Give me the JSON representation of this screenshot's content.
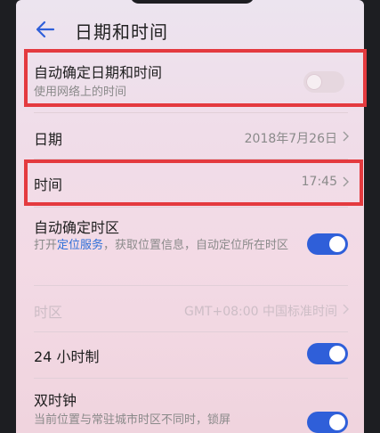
{
  "header": {
    "title": "日期和时间"
  },
  "auto_date_time": {
    "label": "自动确定日期和时间",
    "sub": "使用网络上的时间",
    "enabled": false
  },
  "date": {
    "label": "日期",
    "value": "2018年7月26日"
  },
  "time": {
    "label": "时间",
    "value": "17:45"
  },
  "auto_timezone": {
    "label": "自动确定时区",
    "sub_prefix": "打开",
    "sub_link": "定位服务",
    "sub_suffix": "，获取位置信息，自动定位所在时区",
    "enabled": true
  },
  "timezone": {
    "label": "时区",
    "value": "GMT+08:00 中国标准时间"
  },
  "hour24": {
    "label": "24 小时制",
    "enabled": true
  },
  "dual_clock": {
    "label": "双时钟",
    "sub": "当前位置与常驻城市时区不同时，锁屏",
    "enabled": true
  },
  "colors": {
    "accent": "#2f5fd9",
    "highlight": "#e43a3f",
    "link": "#2f6fd8"
  }
}
